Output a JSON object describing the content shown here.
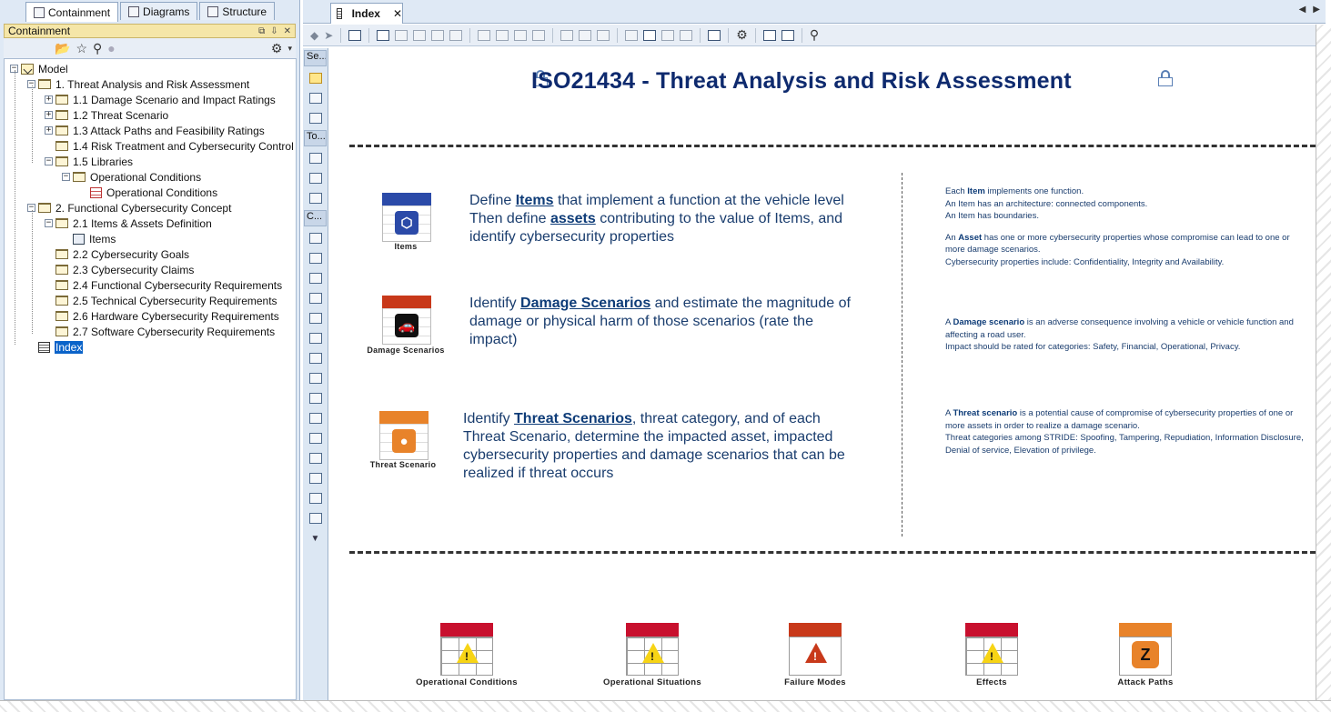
{
  "containment_panel": {
    "tabs": [
      {
        "label": "Containment",
        "active": true,
        "icon": "containment-icon"
      },
      {
        "label": "Diagrams",
        "active": false,
        "icon": "diagrams-icon"
      },
      {
        "label": "Structure",
        "active": false,
        "icon": "structure-icon"
      }
    ],
    "title": "Containment",
    "tree": [
      {
        "label": "Model",
        "level": 0,
        "icon": "model",
        "expander": "minus"
      },
      {
        "label": "1. Threat Analysis and Risk Assessment",
        "level": 1,
        "icon": "folder",
        "expander": "minus"
      },
      {
        "label": "1.1 Damage Scenario and Impact Ratings",
        "level": 2,
        "icon": "folder",
        "expander": "plus"
      },
      {
        "label": "1.2 Threat Scenario",
        "level": 2,
        "icon": "folder",
        "expander": "plus"
      },
      {
        "label": "1.3 Attack Paths and Feasibility Ratings",
        "level": 2,
        "icon": "folder",
        "expander": "plus"
      },
      {
        "label": "1.4 Risk Treatment and Cybersecurity Control",
        "level": 2,
        "icon": "folder",
        "expander": "none"
      },
      {
        "label": "1.5 Libraries",
        "level": 2,
        "icon": "folder",
        "expander": "minus"
      },
      {
        "label": "Operational Conditions",
        "level": 3,
        "icon": "folder",
        "expander": "minus"
      },
      {
        "label": "Operational Conditions",
        "level": 4,
        "icon": "table",
        "expander": "none"
      },
      {
        "label": "2. Functional Cybersecurity Concept",
        "level": 1,
        "icon": "folder",
        "expander": "minus"
      },
      {
        "label": "2.1 Items & Assets Definition",
        "level": 2,
        "icon": "folder",
        "expander": "minus"
      },
      {
        "label": "Items",
        "level": 3,
        "icon": "diagram",
        "expander": "none"
      },
      {
        "label": "2.2 Cybersecurity Goals",
        "level": 2,
        "icon": "folder",
        "expander": "none"
      },
      {
        "label": "2.3 Cybersecurity Claims",
        "level": 2,
        "icon": "folder",
        "expander": "none"
      },
      {
        "label": "2.4 Functional Cybersecurity Requirements",
        "level": 2,
        "icon": "folder",
        "expander": "none"
      },
      {
        "label": "2.5 Technical Cybersecurity Requirements",
        "level": 2,
        "icon": "folder",
        "expander": "none"
      },
      {
        "label": "2.6 Hardware Cybersecurity Requirements",
        "level": 2,
        "icon": "folder",
        "expander": "none"
      },
      {
        "label": "2.7 Software Cybersecurity Requirements",
        "level": 2,
        "icon": "folder",
        "expander": "none"
      },
      {
        "label": "Index",
        "level": 1,
        "icon": "index",
        "expander": "none",
        "selected": true
      }
    ]
  },
  "palette": {
    "sections": [
      "Se...",
      "To...",
      "C..."
    ]
  },
  "editor": {
    "tab_label": "Index",
    "close_glyph": "✕"
  },
  "diagram": {
    "title": "ISO21434 - Threat Analysis and Risk Assessment",
    "steps": [
      {
        "icon_label": "Items",
        "header_color": "#2b4aa8",
        "glyph_color": "#2b4aa8",
        "text_before": "Define ",
        "link1": "Items",
        "text_mid": " that implement a function at the vehicle level Then define ",
        "link2": "assets",
        "text_after": " contributing to the value of Items, and identify cybersecurity properties",
        "note_lines": [
          {
            "pre": "Each ",
            "bold": "Item",
            "post": " implements one function."
          },
          {
            "pre": "An Item has an architecture: connected components.",
            "bold": "",
            "post": ""
          },
          {
            "pre": "An Item has boundaries.",
            "bold": "",
            "post": ""
          },
          {
            "pre": "",
            "bold": "",
            "post": ""
          },
          {
            "pre": "An ",
            "bold": "Asset",
            "post": " has one or more cybersecurity properties whose compromise can lead to one or more damage scenarios."
          },
          {
            "pre": "Cybersecurity properties include: Confidentiality, Integrity and Availability.",
            "bold": "",
            "post": ""
          }
        ]
      },
      {
        "icon_label": "Damage Scenarios",
        "header_color": "#c8391a",
        "glyph_color": "#111111",
        "text_before": "Identify ",
        "link1": "Damage Scenarios",
        "text_mid": " and estimate the magnitude of damage or physical harm of those scenarios (rate the impact)",
        "link2": "",
        "text_after": "",
        "note_lines": [
          {
            "pre": "A ",
            "bold": "Damage scenario",
            "post": " is an adverse consequence involving a vehicle or vehicle function and affecting a road user."
          },
          {
            "pre": "Impact should be rated for categories: Safety, Financial, Operational, Privacy.",
            "bold": "",
            "post": ""
          }
        ]
      },
      {
        "icon_label": "Threat Scenario",
        "header_color": "#e8832a",
        "glyph_color": "#e8832a",
        "text_before": "Identify ",
        "link1": "Threat Scenarios",
        "text_mid": ", threat category, and of each Threat Scenario, determine the impacted asset, impacted cybersecurity properties and damage scenarios that can be realized if threat occurs",
        "link2": "",
        "text_after": "",
        "note_lines": [
          {
            "pre": "A ",
            "bold": "Threat scenario",
            "post": " is a potential cause of compromise of cybersecurity properties of one or more assets in order to realize a damage scenario."
          },
          {
            "pre": "Threat categories among STRIDE: Spoofing, Tampering, Repudiation, Information Disclosure, Denial of service, Elevation of privilege.",
            "bold": "",
            "post": ""
          }
        ]
      }
    ],
    "bottom_icons": [
      {
        "label": "Operational Conditions",
        "icon": "warning-table-icon",
        "header_color": "#c8102e"
      },
      {
        "label": "Operational Situations",
        "icon": "warning-table-icon",
        "header_color": "#c8102e"
      },
      {
        "label": "Failure Modes",
        "icon": "failure-mode-icon",
        "header_color": "#c8391a"
      },
      {
        "label": "Effects",
        "icon": "warning-table-icon",
        "header_color": "#c8102e"
      },
      {
        "label": "Attack Paths",
        "icon": "attack-path-icon",
        "header_color": "#e8832a"
      }
    ]
  }
}
